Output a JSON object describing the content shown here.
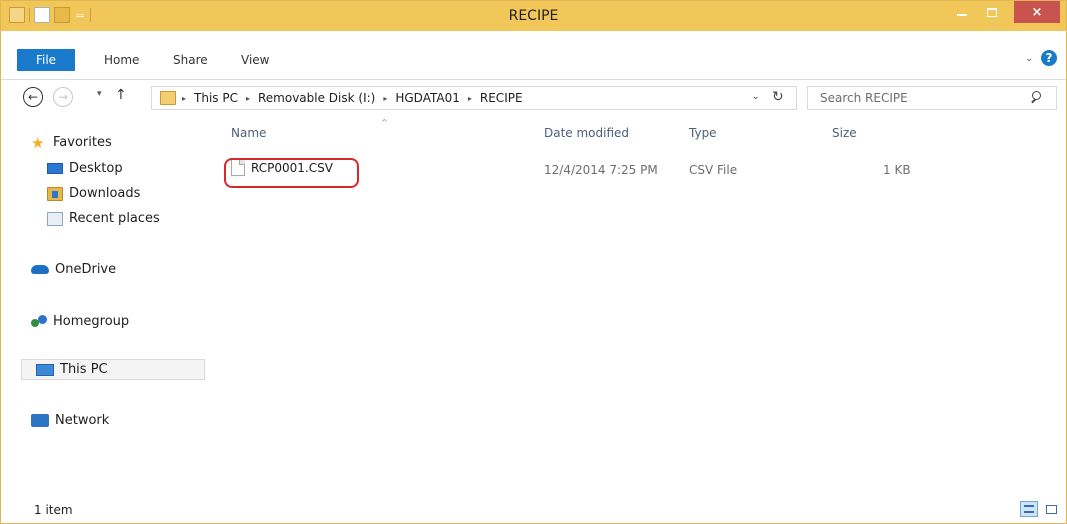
{
  "window": {
    "title": "RECIPE",
    "close_glyph": "×",
    "qat_dropdown_glyph": "="
  },
  "ribbon": {
    "tabs": [
      "File",
      "Home",
      "Share",
      "View"
    ],
    "help_glyph": "?",
    "expand_glyph": "⌄"
  },
  "nav": {
    "back_glyph": "←",
    "forward_glyph": "→",
    "recent_glyph": "▾",
    "up_glyph": "↑",
    "breadcrumb": [
      "This PC",
      "Removable Disk (I:)",
      "HGDATA01",
      "RECIPE"
    ],
    "crumb_separator": "▸",
    "address_dropdown_glyph": "⌄",
    "refresh_glyph": "↻",
    "search_placeholder": "Search RECIPE"
  },
  "navpane": {
    "favorites_label": "Favorites",
    "favorites": [
      "Desktop",
      "Downloads",
      "Recent places"
    ],
    "onedrive_label": "OneDrive",
    "homegroup_label": "Homegroup",
    "thispc_label": "This PC",
    "network_label": "Network",
    "selected": "This PC"
  },
  "content": {
    "columns": {
      "name": "Name",
      "date": "Date modified",
      "type": "Type",
      "size": "Size"
    },
    "sort_glyph": "^",
    "files": [
      {
        "name": "RCP0001.CSV",
        "date": "12/4/2014 7:25 PM",
        "type": "CSV File",
        "size": "1 KB",
        "highlighted": true
      }
    ]
  },
  "status": {
    "item_count": "1 item"
  },
  "colors": {
    "titlebar": "#f1c75a",
    "file_tab": "#1979ca",
    "close_button": "#c7544e",
    "highlight_outline": "#d62a2a"
  }
}
